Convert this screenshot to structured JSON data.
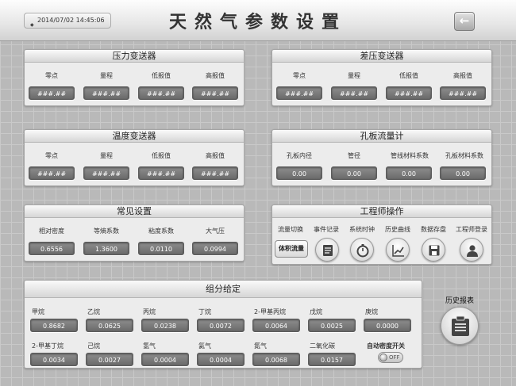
{
  "header": {
    "datetime": "2014/07/02 14:45:06",
    "title": "天然气参数设置"
  },
  "pressure": {
    "title": "压力变送器",
    "labels": [
      "零点",
      "量程",
      "低报值",
      "高报值"
    ],
    "values": [
      "###.##",
      "###.##",
      "###.##",
      "###.##"
    ]
  },
  "diffpress": {
    "title": "差压变送器",
    "labels": [
      "零点",
      "量程",
      "低报值",
      "高报值"
    ],
    "values": [
      "###.##",
      "###.##",
      "###.##",
      "###.##"
    ]
  },
  "temperature": {
    "title": "温度变送器",
    "labels": [
      "零点",
      "量程",
      "低报值",
      "高报值"
    ],
    "values": [
      "###.##",
      "###.##",
      "###.##",
      "###.##"
    ]
  },
  "orifice": {
    "title": "孔板流量计",
    "labels": [
      "孔板内径",
      "管径",
      "管线材料系数",
      "孔板材料系数"
    ],
    "values": [
      "0.00",
      "0.00",
      "0.00",
      "0.00"
    ]
  },
  "common": {
    "title": "常见设置",
    "labels": [
      "相对密度",
      "等熵系数",
      "粘度系数",
      "大气压"
    ],
    "values": [
      "0.6556",
      "1.3600",
      "0.0110",
      "0.0994"
    ]
  },
  "engineer": {
    "title": "工程师操作",
    "labels": [
      "流量切换",
      "事件记录",
      "系统时钟",
      "历史曲线",
      "数据存盘",
      "工程师登录"
    ],
    "flow_button": "体积流量",
    "icons": [
      "notepad-icon",
      "stopwatch-icon",
      "line-chart-icon",
      "save-disk-icon",
      "user-icon"
    ]
  },
  "components": {
    "title": "组分给定",
    "row1_labels": [
      "甲烷",
      "乙烷",
      "丙烷",
      "丁烷",
      "2-甲基丙烷",
      "戊烷",
      "庚烷"
    ],
    "row1_values": [
      "0.8682",
      "0.0625",
      "0.0238",
      "0.0072",
      "0.0064",
      "0.0025",
      "0.0000"
    ],
    "row2_labels": [
      "2-甲基丁烷",
      "己烷",
      "氢气",
      "氦气",
      "氮气",
      "二氧化碳"
    ],
    "row2_values": [
      "0.0034",
      "0.0027",
      "0.0004",
      "0.0004",
      "0.0068",
      "0.0157"
    ],
    "auto_density_label": "自动密度开关",
    "toggle_text": "OFF"
  },
  "history_report": {
    "label": "历史报表",
    "icon": "report-icon"
  },
  "colors": {
    "value_box": "#777777",
    "panel_bg": "#ececec",
    "background": "#b9b9b9"
  }
}
